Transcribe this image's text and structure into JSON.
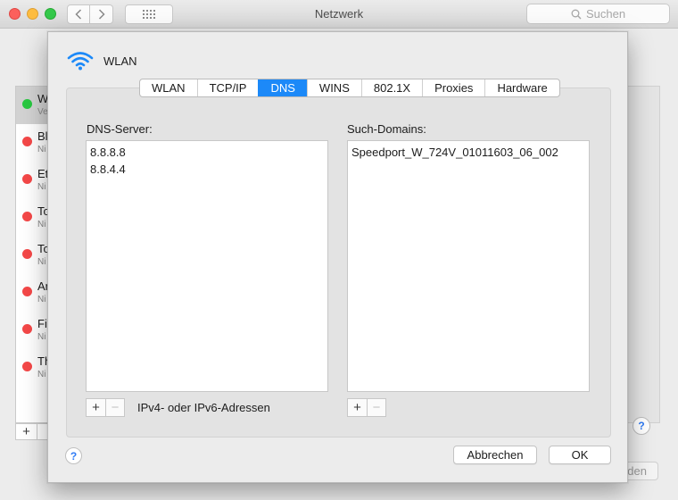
{
  "window": {
    "title": "Netzwerk",
    "search_placeholder": "Suchen"
  },
  "background": {
    "services": [
      {
        "name": "W",
        "status": "Ve",
        "color": "green",
        "selected": true
      },
      {
        "name": "Bl",
        "status": "Ni",
        "color": "red"
      },
      {
        "name": "Et",
        "status": "Ni",
        "color": "red"
      },
      {
        "name": "To",
        "status": "Ni",
        "color": "red"
      },
      {
        "name": "To",
        "status": "Ni",
        "color": "red"
      },
      {
        "name": "Ar",
        "status": "Ni",
        "color": "red"
      },
      {
        "name": "Fi",
        "status": "Ni",
        "color": "red"
      },
      {
        "name": "Th",
        "status": "Ni",
        "color": "red"
      }
    ],
    "plus_label": "+",
    "bottom_button_fragment": "den",
    "help_label": "?"
  },
  "sheet": {
    "title": "WLAN",
    "icon": "wifi-icon",
    "tabs": [
      "WLAN",
      "TCP/IP",
      "DNS",
      "WINS",
      "802.1X",
      "Proxies",
      "Hardware"
    ],
    "active_tab": "DNS",
    "dns": {
      "label": "DNS-Server:",
      "servers": [
        "8.8.8.8",
        "8.8.4.4"
      ],
      "hint": "IPv4- oder IPv6-Adressen"
    },
    "domains": {
      "label": "Such-Domains:",
      "entries": [
        "Speedport_W_724V_01011603_06_002"
      ]
    },
    "add_label": "+",
    "remove_label": "−",
    "help_label": "?",
    "cancel_label": "Abbrechen",
    "ok_label": "OK"
  },
  "colors": {
    "accent": "#1c89f8",
    "status_green": "#28c840",
    "status_red": "#f44848",
    "wifi": "#1c89f8"
  }
}
